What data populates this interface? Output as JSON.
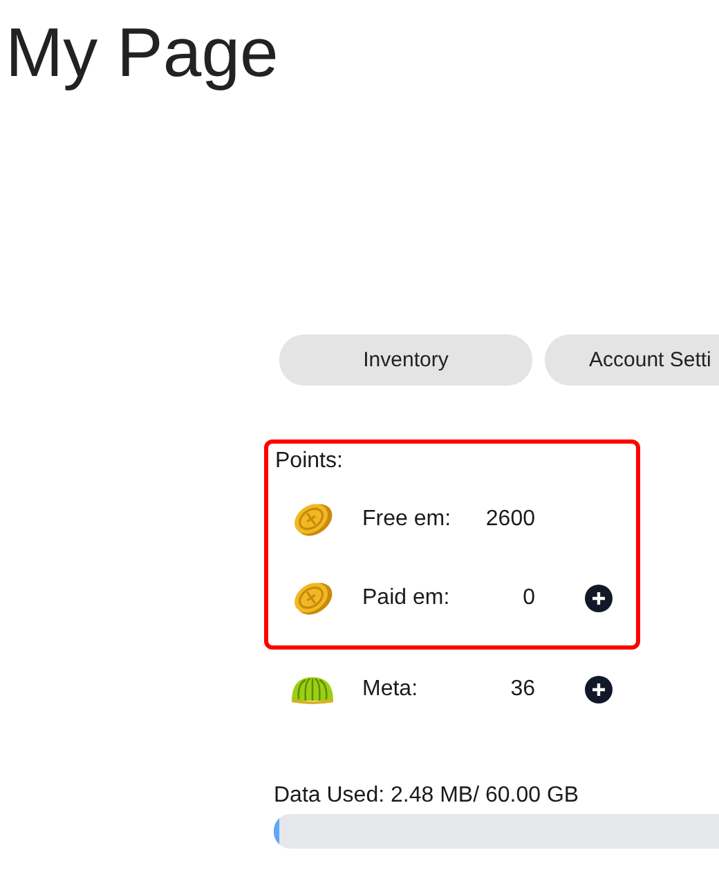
{
  "page_title": "My Page",
  "tabs": [
    {
      "label": "Inventory",
      "selected": false
    },
    {
      "label": "Account Setti",
      "selected": false
    }
  ],
  "points": {
    "title": "Points:",
    "highlighted": true,
    "items": [
      {
        "kind": "coin",
        "label": "Free em:",
        "value": "2600",
        "has_add_button": false
      },
      {
        "kind": "coin",
        "label": "Paid em:",
        "value": "0",
        "has_add_button": true
      }
    ]
  },
  "other_items": [
    {
      "kind": "melon",
      "label": "Meta:",
      "value": "36",
      "has_add_button": true
    }
  ],
  "data_usage": {
    "label": "Data Used: 2.48 MB/ 60.00 GB",
    "level": 4e-05
  }
}
